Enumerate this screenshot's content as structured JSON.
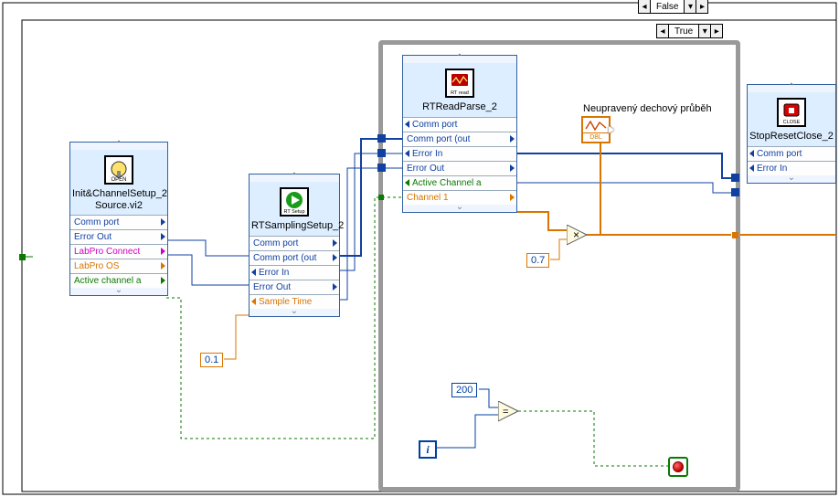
{
  "cases": {
    "outer": "False",
    "inner": "True"
  },
  "nodes": {
    "init": {
      "title": "Init&ChannelSetup_2 Source.vi2",
      "icon_text": "OPEN",
      "t_comm_port": "Comm port",
      "t_error_out": "Error Out",
      "t_labpro_connect": "LabPro Connect",
      "t_labpro_os": "LabPro OS",
      "t_active_channel": "Active channel a"
    },
    "sampling": {
      "title": "RTSamplingSetup_2",
      "icon_text": "RT Setup",
      "t_comm_port_in": "Comm port",
      "t_comm_port_out": "Comm port (out",
      "t_error_in": "Error In",
      "t_error_out": "Error Out",
      "t_sample_time": "Sample Time"
    },
    "read": {
      "title": "RTReadParse_2",
      "icon_text": "RT read",
      "t_comm_port_in": "Comm port",
      "t_comm_port_out": "Comm port (out",
      "t_error_in": "Error In",
      "t_error_out": "Error Out",
      "t_active_channel": "Active Channel a",
      "t_channel1": "Channel 1"
    },
    "stop": {
      "title": "StopResetClose_2",
      "icon_text": "CLOSE",
      "t_comm_port": "Comm port",
      "t_error_in": "Error In"
    }
  },
  "indicator": {
    "caption": "Neupravený dechový průběh",
    "dtype": "DBL"
  },
  "constants": {
    "sample_time": "0.1",
    "gain": "0.7",
    "stop_count": "200"
  },
  "chart_data": null
}
